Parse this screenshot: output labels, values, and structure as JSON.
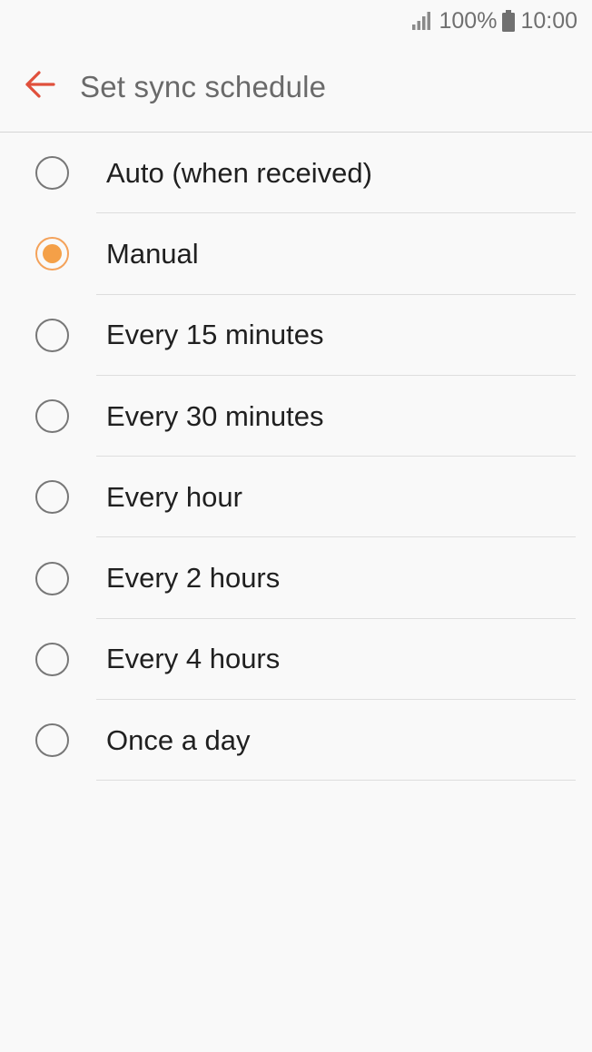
{
  "status_bar": {
    "battery": "100%",
    "time": "10:00",
    "signal_icon": "signal-icon",
    "battery_icon": "battery-icon"
  },
  "header": {
    "back_icon": "back-arrow-icon",
    "title": "Set sync schedule"
  },
  "colors": {
    "accent": "#e0503c",
    "radio_selected": "#f4a048"
  },
  "options": [
    {
      "label": "Auto (when received)",
      "selected": false
    },
    {
      "label": "Manual",
      "selected": true
    },
    {
      "label": "Every 15 minutes",
      "selected": false
    },
    {
      "label": "Every 30 minutes",
      "selected": false
    },
    {
      "label": "Every hour",
      "selected": false
    },
    {
      "label": "Every 2 hours",
      "selected": false
    },
    {
      "label": "Every 4 hours",
      "selected": false
    },
    {
      "label": "Once a day",
      "selected": false
    }
  ]
}
